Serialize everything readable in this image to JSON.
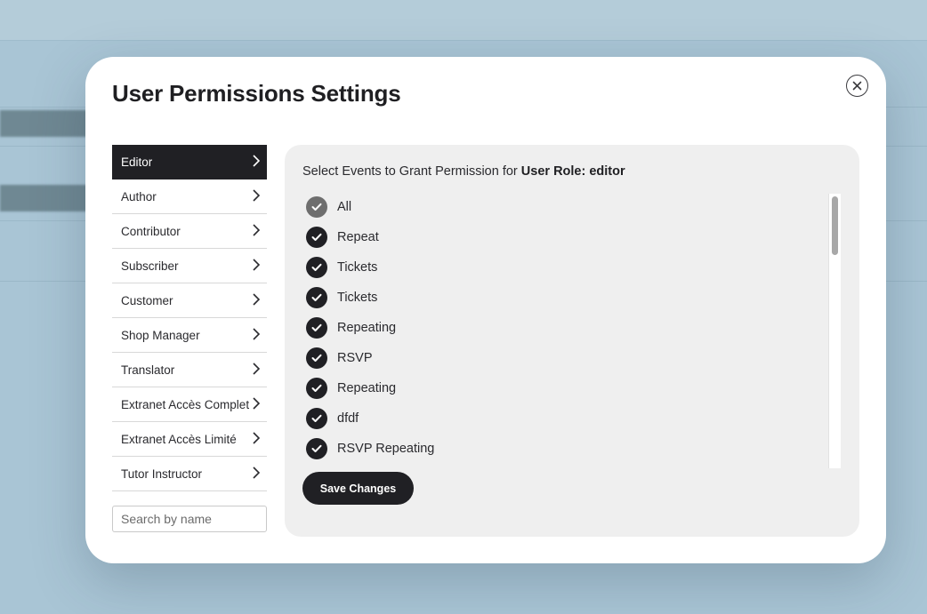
{
  "modal": {
    "title": "User Permissions Settings",
    "close_icon": "close-icon"
  },
  "roles": [
    {
      "label": "Editor",
      "active": true
    },
    {
      "label": "Author"
    },
    {
      "label": "Contributor"
    },
    {
      "label": "Subscriber"
    },
    {
      "label": "Customer"
    },
    {
      "label": "Shop Manager"
    },
    {
      "label": "Translator"
    },
    {
      "label": "Extranet Accès Complet"
    },
    {
      "label": "Extranet Accès Limité"
    },
    {
      "label": "Tutor Instructor"
    }
  ],
  "search": {
    "placeholder": "Search by name"
  },
  "panel": {
    "heading_prefix": "Select Events to Grant Permission for ",
    "heading_role": "User Role: editor",
    "events": [
      {
        "label": "All",
        "checked": true
      },
      {
        "label": "Repeat",
        "checked": true
      },
      {
        "label": "Tickets",
        "checked": true
      },
      {
        "label": "Tickets",
        "checked": true
      },
      {
        "label": "Repeating",
        "checked": true
      },
      {
        "label": "RSVP",
        "checked": true
      },
      {
        "label": "Repeating",
        "checked": true
      },
      {
        "label": "dfdf",
        "checked": true
      },
      {
        "label": "RSVP Repeating",
        "checked": true
      }
    ],
    "save_label": "Save Changes"
  },
  "colors": {
    "accent": "#202024",
    "backdrop": "#a9c5d5",
    "panel": "#efefef"
  }
}
